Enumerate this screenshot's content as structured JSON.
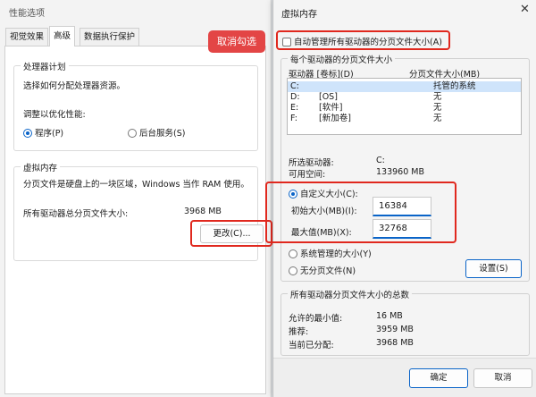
{
  "perf": {
    "title": "性能选项",
    "tabs": [
      "视觉效果",
      "高级",
      "数据执行保护"
    ],
    "processor": {
      "group_title": "处理器计划",
      "description": "选择如何分配处理器资源。",
      "optimize_label": "调整以优化性能:",
      "option_programs": "程序(P)",
      "option_background": "后台服务(S)"
    },
    "virtual_memory": {
      "group_title": "虚拟内存",
      "description": "分页文件是硬盘上的一块区域，Windows 当作 RAM 使用。",
      "total_label": "所有驱动器总分页文件大小:",
      "total_value": "3968 MB",
      "change_button": "更改(C)..."
    }
  },
  "callout": {
    "text": "取消勾选",
    "color": "#e34545"
  },
  "vm": {
    "title": "虚拟内存",
    "auto_manage_label": "自动管理所有驱动器的分页文件大小(A)",
    "auto_manage_checked": false,
    "per_drive_group": "每个驱动器的分页文件大小",
    "col_drive": "驱动器 [卷标](D)",
    "col_size": "分页文件大小(MB)",
    "drives": [
      {
        "drive": "C:",
        "label": "",
        "size": "托管的系统",
        "selected": true
      },
      {
        "drive": "D:",
        "label": "[OS]",
        "size": "无",
        "selected": false
      },
      {
        "drive": "E:",
        "label": "[软件]",
        "size": "无",
        "selected": false
      },
      {
        "drive": "F:",
        "label": "[新加卷]",
        "size": "无",
        "selected": false
      }
    ],
    "selected_drive_label": "所选驱动器:",
    "selected_drive_value": "C:",
    "free_space_label": "可用空间:",
    "free_space_value": "133960 MB",
    "custom_size_label": "自定义大小(C):",
    "initial_label": "初始大小(MB)(I):",
    "initial_value": "16384",
    "max_label": "最大值(MB)(X):",
    "max_value": "32768",
    "system_managed_label": "系统管理的大小(Y)",
    "no_paging_label": "无分页文件(N)",
    "set_button": "设置(S)",
    "total_group": "所有驱动器分页文件大小的总数",
    "min_allowed_label": "允许的最小值:",
    "min_allowed_value": "16 MB",
    "recommended_label": "推荐:",
    "recommended_value": "3959 MB",
    "current_label": "当前已分配:",
    "current_value": "3968 MB",
    "ok_button": "确定",
    "cancel_button": "取消",
    "close_glyph": "✕"
  },
  "colors": {
    "accent": "#0a64c8",
    "highlight_border": "#e0281e",
    "selection": "#cfe4fb"
  }
}
